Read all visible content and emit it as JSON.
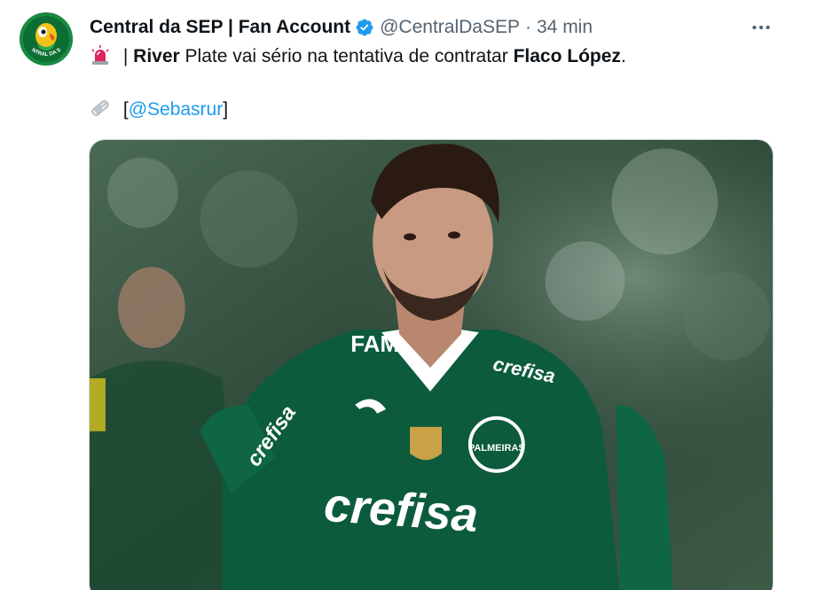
{
  "author": {
    "display_name": "Central da SEP | Fan Account",
    "handle": "@CentralDaSEP",
    "separator": "·",
    "time": "34 min",
    "verified_icon": "verified-badge-icon",
    "avatar_label": "CENTRAL DA SEP"
  },
  "tweet": {
    "emoji_1": "rotating-light-icon",
    "pipe": "|",
    "bold_1": "River",
    "text_1": " Plate vai sério na tentativa de contratar ",
    "bold_2": "Flaco López",
    "text_2": ".",
    "emoji_2": "newspaper-icon",
    "bracket_open": "[",
    "mention": "@Sebasrur",
    "bracket_close": "]"
  },
  "media": {
    "jersey_sponsor": "crefisa",
    "jersey_brand": "FAM",
    "jersey_club": "PALMEIRAS",
    "colors": {
      "jersey": "#0c5b3c",
      "background": "#2e4a39",
      "skin": "#c89a82",
      "hair": "#2a1a12"
    }
  },
  "actions": {
    "more_icon": "more-options-icon"
  }
}
